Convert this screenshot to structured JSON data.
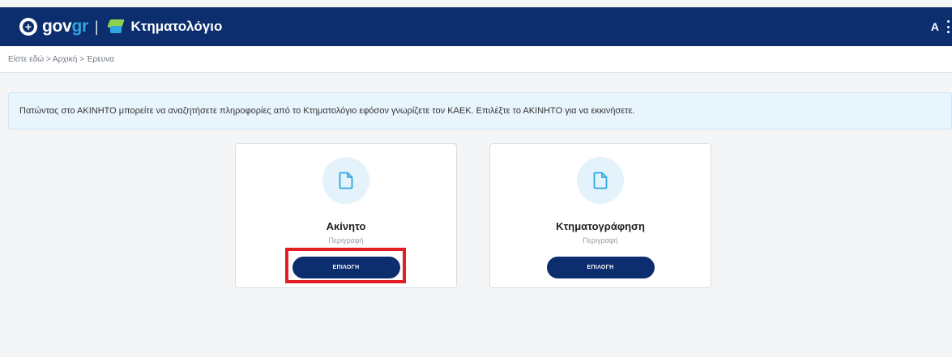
{
  "header": {
    "gov_text": "gov",
    "gov_accent": "gr",
    "separator": "|",
    "app_title": "Κτηματολόγιο",
    "user_initial": "A",
    "icons": [
      "gov-emblem-icon",
      "ktimatologio-logo-icon",
      "more-vert-icon"
    ]
  },
  "breadcrumb": {
    "text": "Είστε εδώ > Αρχική > Έρευνα"
  },
  "info_banner": {
    "text": "Πατώντας στο ΑΚΙΝΗΤΟ μπορείτε να αναζητήσετε πληροφορίες από το Κτηματολόγιο εφόσον γνωρίζετε τον ΚΑΕΚ. Επιλέξτε το ΑΚΙΝΗΤΟ για να εκκινήσετε."
  },
  "cards": [
    {
      "icon": "document-icon",
      "title": "Ακίνητο",
      "description": "Περιγραφή",
      "button_label": "ΕΠΙΛΟΓΗ",
      "highlighted": true
    },
    {
      "icon": "document-icon",
      "title": "Κτηματογράφηση",
      "description": "Περιγραφή",
      "button_label": "ΕΠΙΛΟΓΗ",
      "highlighted": false
    }
  ],
  "colors": {
    "header_bg": "#0c2e6e",
    "gov_accent": "#2fa6e0",
    "button_bg": "#0c2e6e",
    "icon_circle": "#e3f2fb",
    "banner_bg": "#e9f5fd",
    "highlight": "#e41e25"
  }
}
